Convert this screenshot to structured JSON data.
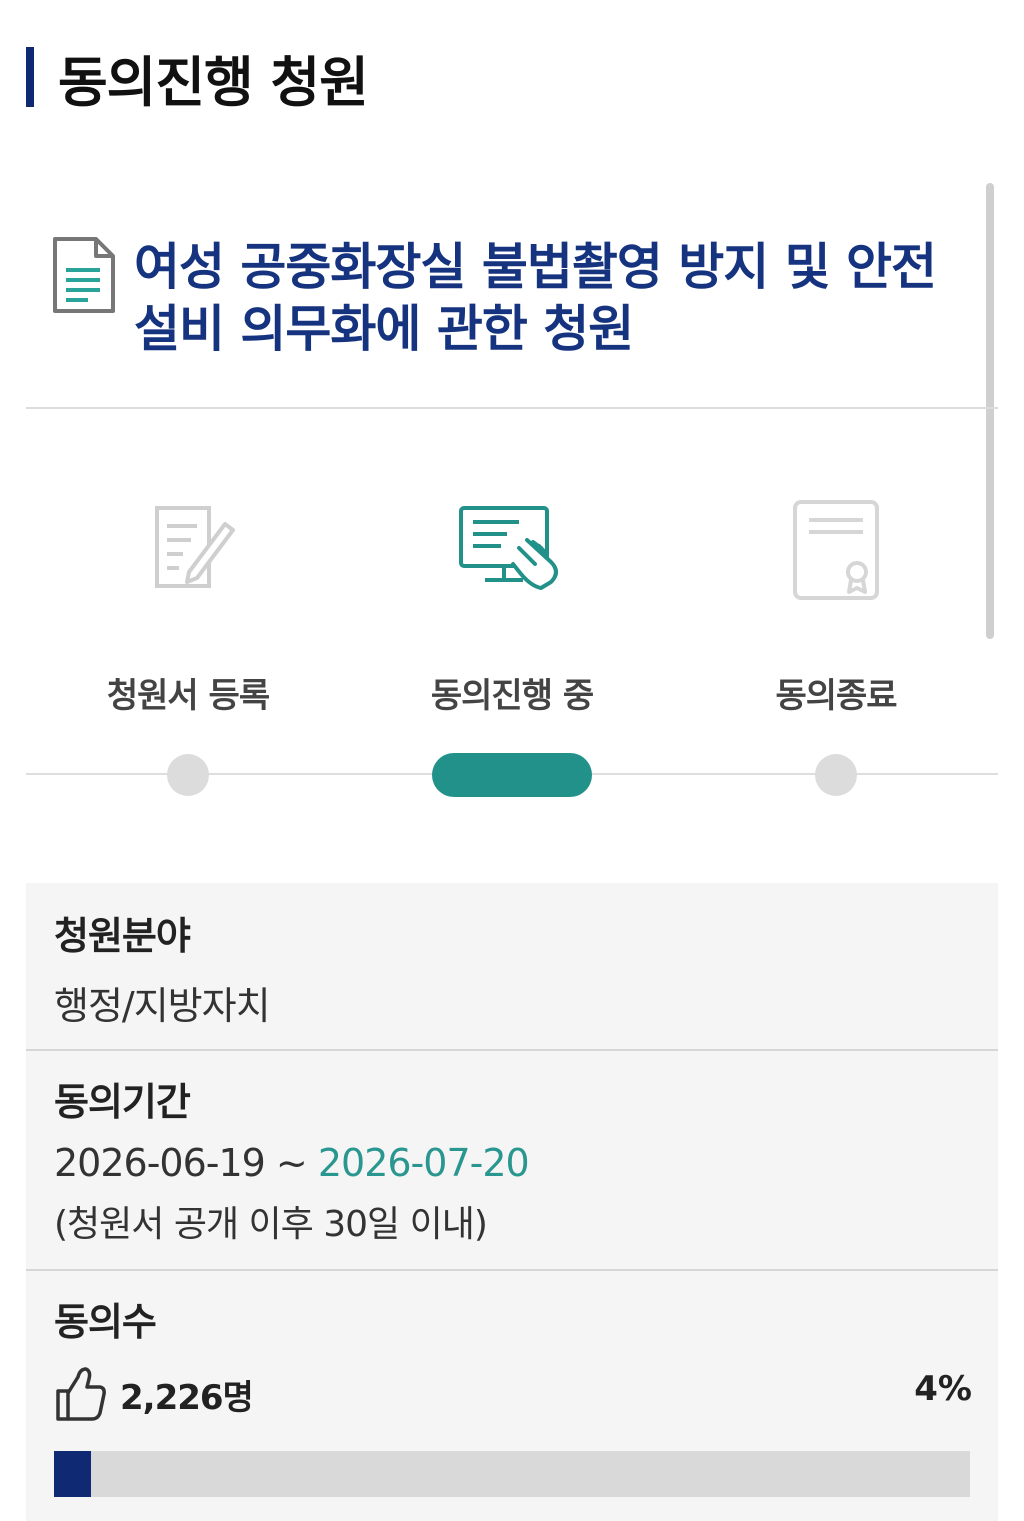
{
  "header": {
    "title": "동의진행 청원"
  },
  "petition": {
    "title": "여성 공중화장실 불법촬영 방지 및 안전 설비 의무화에 관한 청원"
  },
  "steps": [
    {
      "label": "청원서 등록",
      "icon": "pen-document-icon",
      "active": false
    },
    {
      "label": "동의진행 중",
      "icon": "monitor-touch-icon",
      "active": true
    },
    {
      "label": "동의종료",
      "icon": "certificate-icon",
      "active": false
    }
  ],
  "info": {
    "field_label": "청원분야",
    "field_value": "행정/지방자치",
    "period_label": "동의기간",
    "period_start": "2026-06-19",
    "period_sep": " ~ ",
    "period_end": "2026-07-20",
    "period_note": "(청원서 공개 이후 30일 이내)",
    "count_label": "동의수",
    "count_value": "2,226명",
    "percent_label": "4%",
    "progress": 0.04
  },
  "colors": {
    "navy": "#0f2a72",
    "teal": "#22918a",
    "title_blue": "#16337f"
  }
}
